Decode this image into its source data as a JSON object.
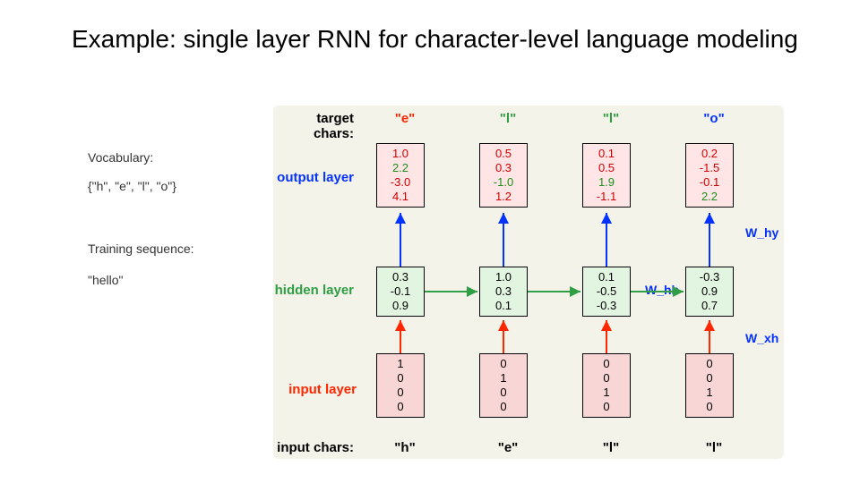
{
  "title": "Example: single layer RNN for character-level language modeling",
  "left": {
    "vocab_label": "Vocabulary:",
    "vocab_set": "{\"h\", \"e\", \"l\", \"o\"}",
    "train_label": "Training sequence:",
    "train_seq": "\"hello\""
  },
  "labels": {
    "target": "target chars:",
    "output": "output layer",
    "hidden": "hidden layer",
    "input": "input layer",
    "inchars": "input chars:"
  },
  "weights": {
    "why": "W_hy",
    "whh": "W_hh",
    "wxh": "W_xh"
  },
  "cols": [
    {
      "target": "\"e\"",
      "output": [
        "1.0",
        "2.2",
        "-3.0",
        "4.1"
      ],
      "out_classes": [
        "red",
        "grn",
        "red",
        "red"
      ],
      "hidden": [
        "0.3",
        "-0.1",
        "0.9"
      ],
      "input": [
        "1",
        "0",
        "0",
        "0"
      ],
      "inchar": "\"h\""
    },
    {
      "target": "\"l\"",
      "output": [
        "0.5",
        "0.3",
        "-1.0",
        "1.2"
      ],
      "out_classes": [
        "red",
        "red",
        "grn",
        "red"
      ],
      "hidden": [
        "1.0",
        "0.3",
        "0.1"
      ],
      "input": [
        "0",
        "1",
        "0",
        "0"
      ],
      "inchar": "\"e\""
    },
    {
      "target": "\"l\"",
      "output": [
        "0.1",
        "0.5",
        "1.9",
        "-1.1"
      ],
      "out_classes": [
        "red",
        "red",
        "grn",
        "red"
      ],
      "hidden": [
        "0.1",
        "-0.5",
        "-0.3"
      ],
      "input": [
        "0",
        "0",
        "1",
        "0"
      ],
      "inchar": "\"l\""
    },
    {
      "target": "\"o\"",
      "output": [
        "0.2",
        "-1.5",
        "-0.1",
        "2.2"
      ],
      "out_classes": [
        "red",
        "red",
        "red",
        "grn"
      ],
      "hidden": [
        "-0.3",
        "0.9",
        "0.7"
      ],
      "input": [
        "0",
        "0",
        "1",
        "0"
      ],
      "inchar": "\"l\""
    }
  ]
}
